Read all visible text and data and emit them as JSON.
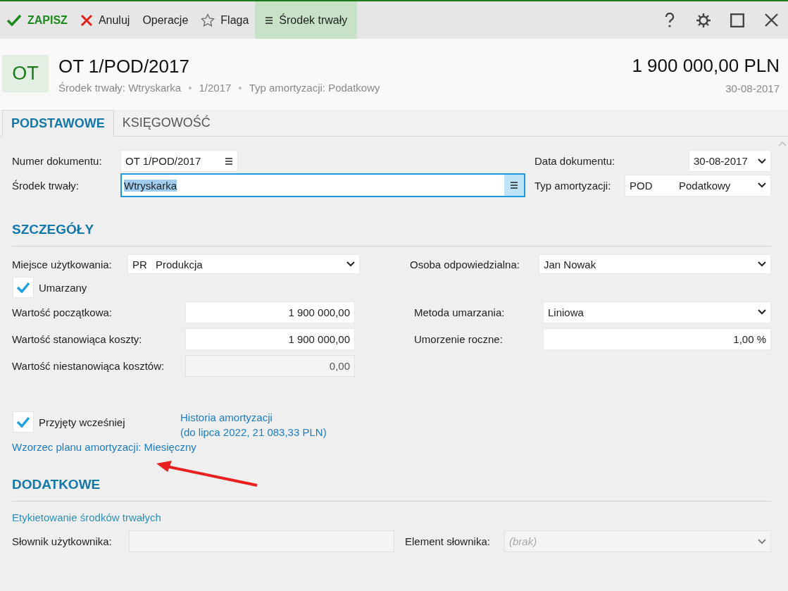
{
  "toolbar": {
    "items": [
      {
        "kind": "save",
        "label": "ZAPISZ",
        "selected": false
      },
      {
        "kind": "cancel",
        "label": "Anuluj",
        "selected": false
      },
      {
        "kind": "plain",
        "label": "Operacje",
        "selected": false
      },
      {
        "kind": "flag",
        "label": "Flaga",
        "selected": false
      },
      {
        "kind": "menu",
        "label": "Środek trwały",
        "selected": true
      }
    ]
  },
  "header": {
    "badge": "OT",
    "title": "OT 1/POD/2017",
    "subtitle": [
      "Środek trwały: Wtryskarka",
      "1/2017",
      "Typ amortyzacji: Podatkowy"
    ],
    "separator": "•",
    "amount": "1 900 000,00 PLN",
    "date": "30-08-2017"
  },
  "tabs": [
    {
      "label": "PODSTAWOWE",
      "selected": true
    },
    {
      "label": "KSIĘGOWOŚĆ",
      "selected": false
    }
  ],
  "document": {
    "numer_dokumentu": {
      "label": "Numer dokumentu:",
      "value": "OT 1/POD/2017"
    },
    "srodek_trwaly": {
      "label": "Środek trwały:",
      "value": "Wtryskarka"
    },
    "data_dokumentu": {
      "label": "Data dokumentu:",
      "value": "30-08-2017"
    },
    "typ_amortyzacji": {
      "label": "Typ amortyzacji:",
      "code": "POD",
      "value": "Podatkowy"
    }
  },
  "szczegoly": {
    "title": "SZCZEGÓŁY",
    "miejsce": {
      "label": "Miejsce użytkowania:",
      "code": "PR",
      "value": "Produkcja"
    },
    "osoba": {
      "label": "Osoba odpowiedzialna:",
      "value": "Jan Nowak"
    },
    "umarzany": {
      "label": "Umarzany",
      "checked": true
    },
    "wartosc_poczatkowa": {
      "label": "Wartość początkowa:",
      "value": "1 900 000,00"
    },
    "metoda": {
      "label": "Metoda umarzania:",
      "value": "Liniowa"
    },
    "wartosc_koszty": {
      "label": "Wartość stanowiąca koszty:",
      "value": "1 900 000,00"
    },
    "umorzenie": {
      "label": "Umorzenie roczne:",
      "value": "1,00 %"
    },
    "wartosc_niekoszty": {
      "label": "Wartość niestanowiąca kosztów:",
      "value": "0,00",
      "disabled": true
    },
    "przyjety": {
      "label": "Przyjęty wcześniej",
      "checked": true
    },
    "historia": [
      "Historia amortyzacji",
      "(do lipca 2022, 21 083,33 PLN)"
    ],
    "wzorzec": "Wzorzec planu amortyzacji: Miesięczny"
  },
  "dodatkowe": {
    "title": "DODATKOWE",
    "link": "Etykietowanie środków trwałych",
    "slownik": {
      "label": "Słownik użytkownika:",
      "disabled": true
    },
    "element": {
      "label": "Element słownika:",
      "placeholder": "(brak)",
      "disabled": true
    }
  }
}
